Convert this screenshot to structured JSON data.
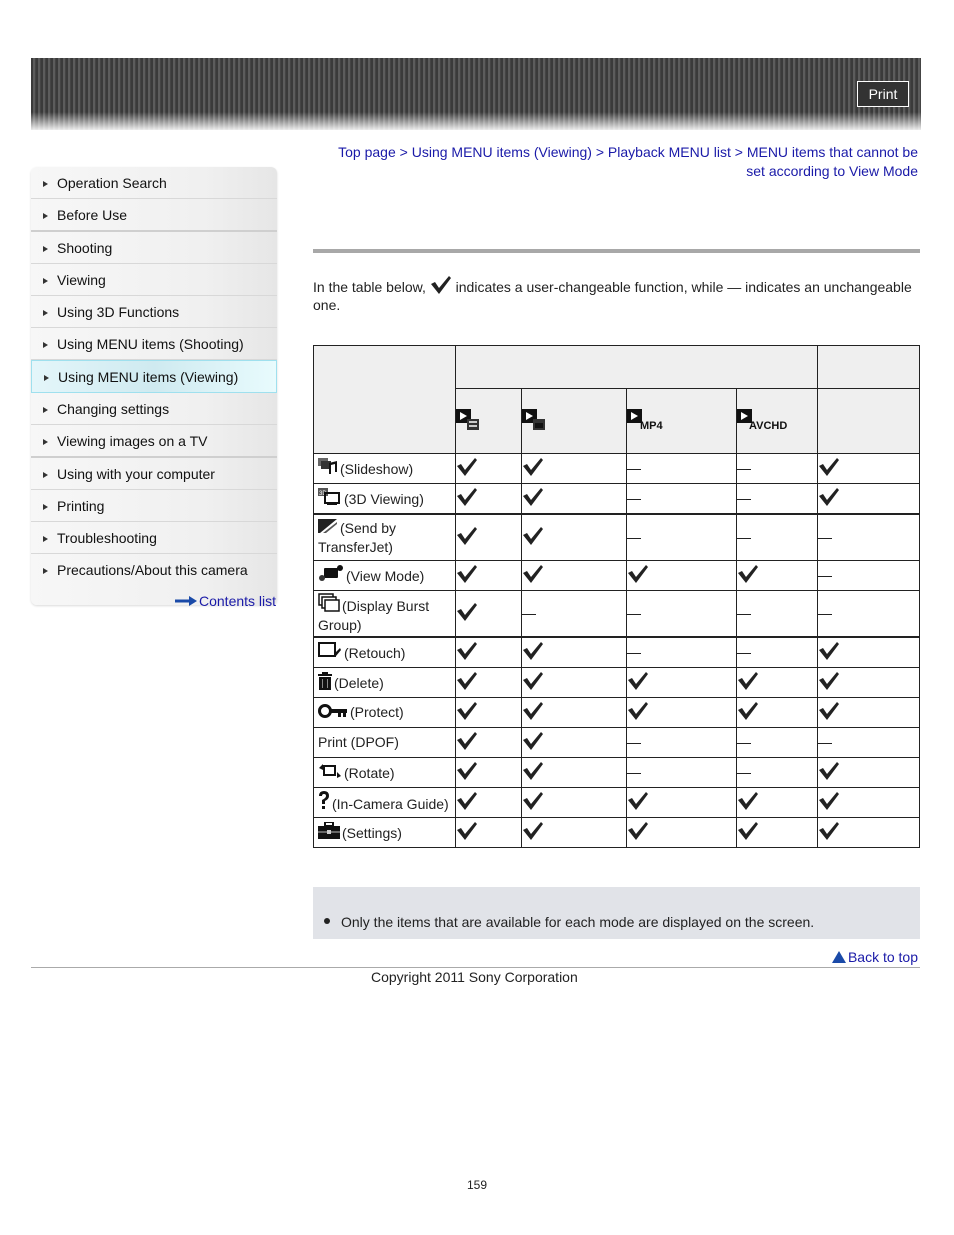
{
  "header": {
    "print_label": "Print"
  },
  "sidebar": {
    "items": [
      {
        "label": "Operation Search",
        "active": false
      },
      {
        "label": "Before Use",
        "active": false
      },
      {
        "label": "Shooting",
        "active": false
      },
      {
        "label": "Viewing",
        "active": false
      },
      {
        "label": "Using 3D Functions",
        "active": false
      },
      {
        "label": "Using MENU items (Shooting)",
        "active": false
      },
      {
        "label": "Using MENU items (Viewing)",
        "active": true
      },
      {
        "label": "Changing settings",
        "active": false
      },
      {
        "label": "Viewing images on a TV",
        "active": false
      },
      {
        "label": "Using with your computer",
        "active": false
      },
      {
        "label": "Printing",
        "active": false
      },
      {
        "label": "Troubleshooting",
        "active": false
      },
      {
        "label": "Precautions/About this camera",
        "active": false
      }
    ],
    "contents_link": "Contents list"
  },
  "breadcrumb": {
    "items": [
      "Top page",
      "Using MENU items (Viewing)",
      "Playback MENU list",
      "MENU items that cannot be set according to View Mode"
    ],
    "separator": ">"
  },
  "intro": {
    "before": "In the table below,",
    "after": "indicates a user-changeable function, while — indicates an unchangeable one."
  },
  "table": {
    "columns": [
      {
        "icon": "date-view-icon",
        "label": ""
      },
      {
        "icon": "folder-view-stills-icon",
        "label": ""
      },
      {
        "icon": "folder-view-mp4-icon",
        "label": "MP4"
      },
      {
        "icon": "avchd-view-icon",
        "label": "AVCHD"
      },
      {
        "icon": "",
        "label": ""
      }
    ],
    "rows": [
      {
        "icon": "slideshow-icon",
        "name": "(Slideshow)",
        "values": [
          "check",
          "check",
          "dash",
          "dash",
          "check"
        ]
      },
      {
        "icon": "3d-viewing-icon",
        "name": "(3D Viewing)",
        "values": [
          "check",
          "check",
          "dash",
          "dash",
          "check"
        ]
      },
      {
        "icon": "transferjet-icon",
        "name": "(Send by TransferJet)",
        "values": [
          "check",
          "check",
          "dash",
          "dash",
          "dash"
        ]
      },
      {
        "icon": "view-mode-icon",
        "name": "(View Mode)",
        "values": [
          "check",
          "check",
          "check",
          "check",
          "dash"
        ]
      },
      {
        "icon": "burst-group-icon",
        "name": "(Display Burst Group)",
        "values": [
          "check",
          "dash",
          "dash",
          "dash",
          "dash"
        ]
      },
      {
        "icon": "retouch-icon",
        "name": "(Retouch)",
        "values": [
          "check",
          "check",
          "dash",
          "dash",
          "check"
        ]
      },
      {
        "icon": "delete-icon",
        "name": "(Delete)",
        "values": [
          "check",
          "check",
          "check",
          "check",
          "check"
        ]
      },
      {
        "icon": "protect-icon",
        "name": "(Protect)",
        "values": [
          "check",
          "check",
          "check",
          "check",
          "check"
        ]
      },
      {
        "icon": "",
        "name": "Print (DPOF)",
        "values": [
          "check",
          "check",
          "dash",
          "dash",
          "dash"
        ]
      },
      {
        "icon": "rotate-icon",
        "name": "(Rotate)",
        "values": [
          "check",
          "check",
          "dash",
          "dash",
          "check"
        ]
      },
      {
        "icon": "help-icon",
        "name": "(In-Camera Guide)",
        "values": [
          "check",
          "check",
          "check",
          "check",
          "check"
        ]
      },
      {
        "icon": "settings-toolbox-icon",
        "name": "(Settings)",
        "values": [
          "check",
          "check",
          "check",
          "check",
          "check"
        ]
      }
    ]
  },
  "note": {
    "text": "Only the items that are available for each mode are displayed on the screen."
  },
  "back_to_top": "Back to top",
  "copyright": "Copyright 2011 Sony Corporation",
  "page_number": "159"
}
